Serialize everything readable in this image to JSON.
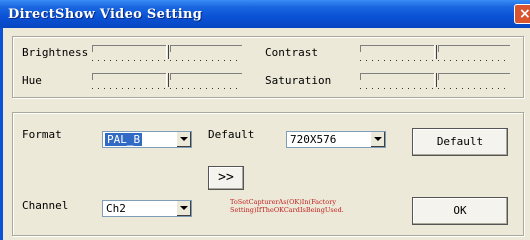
{
  "window": {
    "title": "DirectShow Video Setting",
    "close_glyph": "×"
  },
  "adjust": {
    "brightness_label": "Brightness",
    "contrast_label": "Contrast",
    "hue_label": "Hue",
    "saturation_label": "Saturation"
  },
  "format": {
    "label": "Format",
    "value": "PAL_B"
  },
  "default_size": {
    "label": "Default",
    "value": "720X576"
  },
  "channel": {
    "label": "Channel",
    "value": "Ch2"
  },
  "buttons": {
    "default": "Default",
    "forward": ">>",
    "ok": "OK"
  },
  "hint": "ToSetCapturerAs(OK)In(Factory Setting)IfTheOKCardIsBeingUsed.",
  "colors": {
    "title_bar": "#0a52d6",
    "dialog_bg": "#ece9d8",
    "hint_text": "#c02020",
    "selection": "#316ac5"
  }
}
